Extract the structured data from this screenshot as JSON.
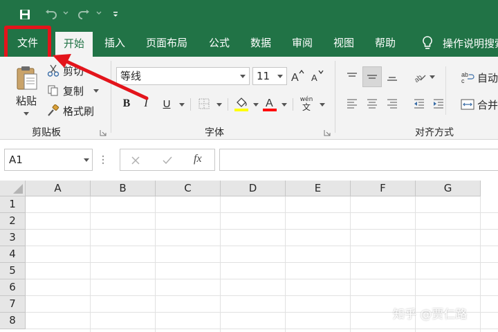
{
  "quick_access": {
    "save_icon": "save-icon",
    "undo_icon": "undo-icon",
    "redo_icon": "redo-icon",
    "customize_icon": "customize-quick-access-icon"
  },
  "tabs": {
    "file": "文件",
    "home": "开始",
    "insert": "插入",
    "page_layout": "页面布局",
    "formulas": "公式",
    "data": "数据",
    "review": "审阅",
    "view": "视图",
    "help": "帮助"
  },
  "tell_me": {
    "label": "操作说明搜索",
    "icon": "lightbulb-icon"
  },
  "clipboard": {
    "paste": "粘贴",
    "cut": "剪切",
    "copy": "复制",
    "format_painter": "格式刷",
    "group_label": "剪贴板"
  },
  "font": {
    "font_name": "等线",
    "font_size": "11",
    "bold": "B",
    "italic": "I",
    "underline": "U",
    "phonetic_top": "wén",
    "phonetic_bottom": "文",
    "fill_color": "#ffff00",
    "font_color": "#ff0000",
    "group_label": "字体"
  },
  "alignment": {
    "wrap_text": "自动",
    "merge": "合并",
    "group_label": "对齐方式"
  },
  "formula_bar": {
    "name_box": "A1",
    "fx": "fx"
  },
  "sheet": {
    "columns": [
      "A",
      "B",
      "C",
      "D",
      "E",
      "F",
      "G"
    ],
    "rows": [
      "1",
      "2",
      "3",
      "4",
      "5",
      "6",
      "7",
      "8"
    ]
  },
  "watermark": "知乎 @贾仁路",
  "colors": {
    "excel_green": "#217346",
    "ribbon_bg": "#f3f3f3",
    "highlight_red": "#e3141b"
  }
}
